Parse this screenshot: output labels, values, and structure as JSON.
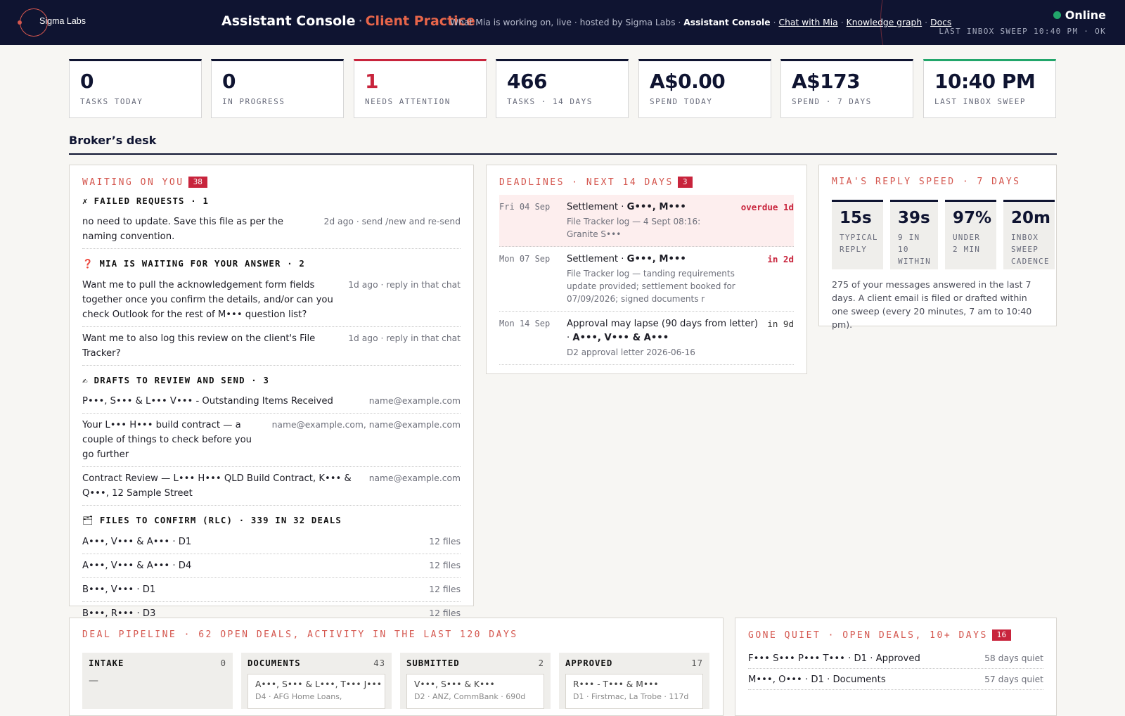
{
  "header": {
    "logo_text": "Sigma Labs",
    "title_main": "Assistant Console",
    "title_sep": "·",
    "title_practice": "Client Practice",
    "tagline": "What Mia is working on, live · hosted by Sigma Labs ·",
    "nav_current": "Assistant Console",
    "nav_links": [
      "Chat with Mia",
      "Knowledge graph",
      "Docs"
    ],
    "nav_sep": "·",
    "status": "Online",
    "sweep_status": "LAST INBOX SWEEP 10:40 PM · OK",
    "status_color": "#22a66b"
  },
  "stats": [
    {
      "value": "0",
      "label": "TASKS TODAY"
    },
    {
      "value": "0",
      "label": "IN PROGRESS"
    },
    {
      "value": "1",
      "label": "NEEDS ATTENTION"
    },
    {
      "value": "466",
      "label": "TASKS · 14 DAYS"
    },
    {
      "value": "A$0.00",
      "label": "SPEND TODAY"
    },
    {
      "value": "A$173",
      "label": "SPEND · 7 DAYS"
    },
    {
      "value": "10:40 PM",
      "label": "LAST INBOX SWEEP"
    }
  ],
  "section_title": "Broker’s desk",
  "waiting": {
    "title": "WAITING ON YOU",
    "count": "38",
    "failed": {
      "icon": "✗",
      "heading": "FAILED REQUESTS · 1",
      "items": [
        {
          "text": "no need to update. Save this file as per the naming convention.",
          "meta": "2d ago · send /new and re-send"
        }
      ]
    },
    "questions": {
      "icon": "❓",
      "heading": "MIA IS WAITING FOR YOUR ANSWER · 2",
      "items": [
        {
          "text": "Want me to pull the acknowledgement form fields together once you confirm the details, and/or can you check Outlook for the rest of M••• question list?",
          "meta": "1d ago · reply in that chat"
        },
        {
          "text": "Want me to also log this review on the client's File Tracker?",
          "meta": "1d ago · reply in that chat"
        }
      ]
    },
    "drafts": {
      "icon": "✍",
      "heading": "DRAFTS TO REVIEW AND SEND · 3",
      "items": [
        {
          "text": "P•••, S••• & L••• V••• - Outstanding Items Received",
          "meta": "name@example.com"
        },
        {
          "text": "Your L••• H••• build contract — a couple of things to check before you go further",
          "meta": "name@example.com, name@example.com"
        },
        {
          "text": "Contract Review — L••• H••• QLD Build Contract, K••• & Q•••, 12 Sample Street",
          "meta": "name@example.com"
        }
      ]
    },
    "files": {
      "icon": "🗂",
      "heading": "FILES TO CONFIRM (RLC) · 339 IN 32 DEALS",
      "items": [
        {
          "text": "A•••, V••• & A••• · D1",
          "meta": "12 files"
        },
        {
          "text": "A•••, V••• & A••• · D4",
          "meta": "12 files"
        },
        {
          "text": "B•••, V••• · D1",
          "meta": "12 files"
        },
        {
          "text": "B•••, R••• · D3",
          "meta": "12 files"
        }
      ]
    }
  },
  "deadlines": {
    "title": "DEADLINES · NEXT 14 DAYS",
    "count": "3",
    "items": [
      {
        "date": "Fri 04 Sep",
        "head": "Settlement · ",
        "head_bold": "G•••, M•••",
        "sub": "File Tracker log — 4 Sept 08:16: Granite S•••",
        "when": "overdue 1d"
      },
      {
        "date": "Mon 07 Sep",
        "head": "Settlement · ",
        "head_bold": "G•••, M•••",
        "sub": "File Tracker log — tanding requirements update provided; settlement booked for 07/09/2026; signed documents r",
        "when": "in 2d"
      },
      {
        "date": "Mon 14 Sep",
        "head": "Approval may lapse (90 days from letter) · ",
        "head_bold": "A•••, V••• & A•••",
        "sub": "D2 approval letter 2026-06-16",
        "when": "in 9d"
      }
    ]
  },
  "reply_speed": {
    "title": "MIA'S REPLY SPEED · 7 DAYS",
    "tiles": [
      {
        "value": "15s",
        "label": "TYPICAL REPLY"
      },
      {
        "value": "39s",
        "label": "9 IN 10 WITHIN"
      },
      {
        "value": "97%",
        "label": "UNDER 2 MIN"
      },
      {
        "value": "20m",
        "label": "INBOX SWEEP CADENCE"
      }
    ],
    "note": "275 of your messages answered in the last 7 days. A client email is filed or drafted within one sweep (every 20 minutes, 7 am to 10:40 pm)."
  },
  "pipeline": {
    "title": "DEAL PIPELINE · 62 OPEN DEALS, ACTIVITY IN THE LAST 120 DAYS",
    "columns": [
      {
        "name": "INTAKE",
        "count": "0",
        "empty": "—"
      },
      {
        "name": "DOCUMENTS",
        "count": "43",
        "card_title": "A•••, S••• & L•••, T••• J•••",
        "card_sub": "D4 · AFG Home Loans,"
      },
      {
        "name": "SUBMITTED",
        "count": "2",
        "card_title": "V•••, S••• & K•••",
        "card_sub": "D2 · ANZ, CommBank · 690d"
      },
      {
        "name": "APPROVED",
        "count": "17",
        "card_title": "R••• - T••• & M•••",
        "card_sub": "D1 · Firstmac, La Trobe · 117d"
      }
    ]
  },
  "gone_quiet": {
    "title": "GONE QUIET · OPEN DEALS, 10+ DAYS",
    "count": "16",
    "items": [
      {
        "text": "F••• S••• P••• T••• · D1 · Approved",
        "meta": "58 days quiet"
      },
      {
        "text": "M•••, O••• · D1 · Documents",
        "meta": "57 days quiet"
      }
    ]
  },
  "colors": {
    "navy": "#0f1431",
    "accent": "#e7654a",
    "alert": "#c8243c",
    "good": "#22a66b"
  }
}
